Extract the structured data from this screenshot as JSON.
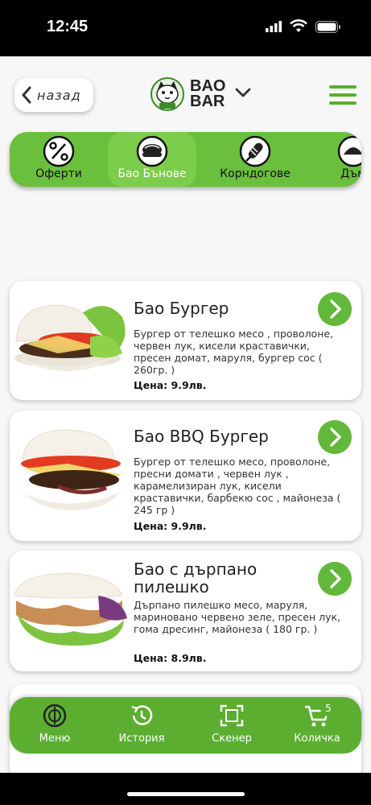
{
  "status_bar": {
    "time": "12:45"
  },
  "header": {
    "back_label": "назад",
    "logo_text_line1": "BAO",
    "logo_text_line2": "BAR"
  },
  "categories": [
    {
      "label": "Оферти",
      "icon": "percent-icon",
      "active": false
    },
    {
      "label": "Бао Бънове",
      "icon": "bun-icon",
      "active": true
    },
    {
      "label": "Корндогове",
      "icon": "corndog-icon",
      "active": false
    },
    {
      "label": "Дъм",
      "icon": "dumpling-icon",
      "active": false
    }
  ],
  "products": [
    {
      "title": "Бао Бургер",
      "description": "Бургер от телешко месо , проволоне, червен лук, кисели краставички, пресен домат, маруля, бургер сос ( 260гр. )",
      "price": "Цена: 9.9лв."
    },
    {
      "title": "Бао BBQ Бургер",
      "description": "Бургер от телешко месо, проволоне, пресни домати , червен лук , карамелизиран лук, кисели краставички, барбекю сос , майонеза ( 245 гр )",
      "price": "Цена: 9.9лв."
    },
    {
      "title_line1": "Бао с дърпано",
      "title_line2": "пилешко",
      "description": "Дърпано пилешко месо, маруля, мариновано червено зеле, пресен лук, гома дресинг, майонеза ( 180 гр. )",
      "price": "Цена: 8.9лв."
    }
  ],
  "bottom_nav": {
    "menu": "Меню",
    "history": "История",
    "scanner": "Скенер",
    "cart": "Количка",
    "cart_count": "5"
  },
  "colors": {
    "accent": "#62b83a",
    "nav_bg": "#5cae30"
  }
}
